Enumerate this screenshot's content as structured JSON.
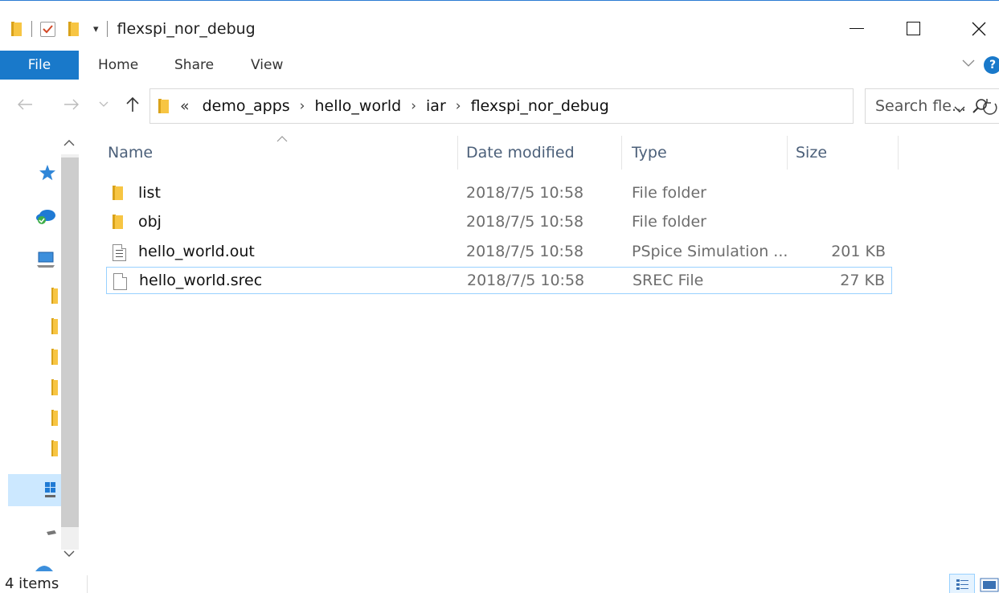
{
  "window": {
    "title": "flexspi_nor_debug"
  },
  "ribbon": {
    "tabs": {
      "file": "File",
      "home": "Home",
      "share": "Share",
      "view": "View"
    }
  },
  "address": {
    "overflow": "«",
    "crumbs": [
      "demo_apps",
      "hello_world",
      "iar",
      "flexspi_nor_debug"
    ],
    "search_placeholder": "Search fle..."
  },
  "columns": {
    "name": "Name",
    "date": "Date modified",
    "type": "Type",
    "size": "Size"
  },
  "files": [
    {
      "name": "list",
      "date": "2018/7/5 10:58",
      "type": "File folder",
      "size": "",
      "icon": "folder-icon"
    },
    {
      "name": "obj",
      "date": "2018/7/5 10:58",
      "type": "File folder",
      "size": "",
      "icon": "folder-icon"
    },
    {
      "name": "hello_world.out",
      "date": "2018/7/5 10:58",
      "type": "PSpice Simulation ...",
      "size": "201 KB",
      "icon": "text-file-icon"
    },
    {
      "name": "hello_world.srec",
      "date": "2018/7/5 10:58",
      "type": "SREC File",
      "size": "27 KB",
      "icon": "blank-file-icon"
    }
  ],
  "status": {
    "item_count": "4 items"
  },
  "colors": {
    "accent": "#1979ca",
    "folder": "#f7c543",
    "selection_border": "#99d1ff"
  }
}
